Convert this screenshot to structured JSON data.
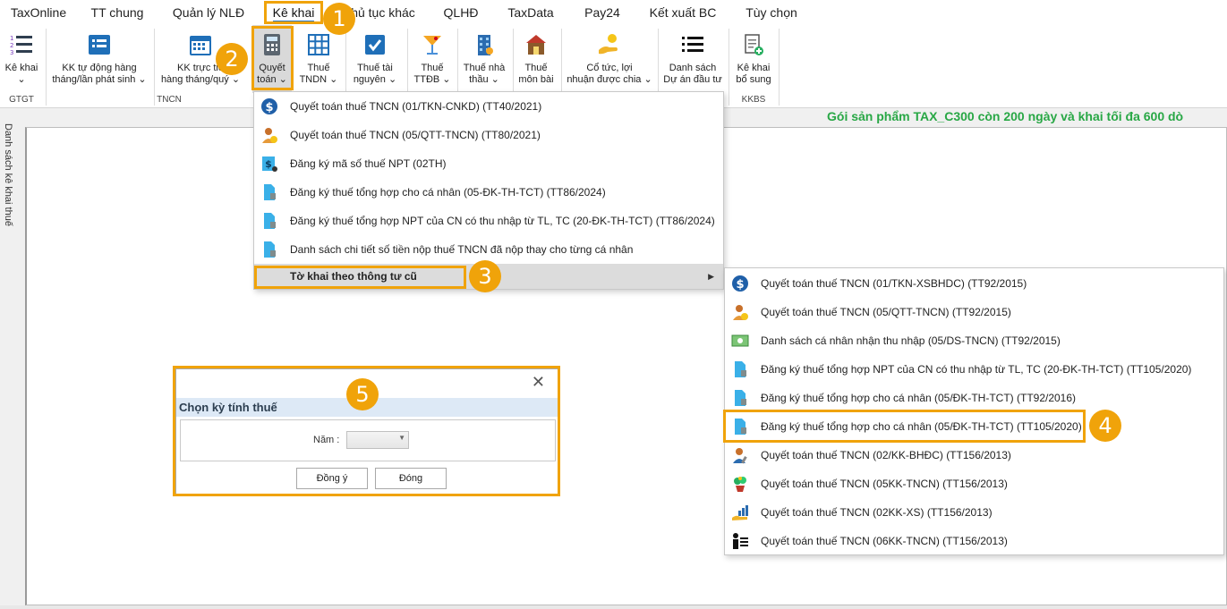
{
  "menu": [
    "TaxOnline",
    "TT chung",
    "Quản lý NLĐ",
    "Kê khai",
    "hủ tục khác",
    "QLHĐ",
    "TaxData",
    "Pay24",
    "Kết xuất BC",
    "Tùy chọn"
  ],
  "ribbon": {
    "buttons": [
      {
        "line1": "Kê khai",
        "line2": "⌄",
        "icon": "numbered-list-icon"
      },
      {
        "line1": "KK tự động hàng",
        "line2": "tháng/lần phát sinh ⌄",
        "icon": "form-list-icon"
      },
      {
        "line1": "KK trực tiế",
        "line2": "hàng tháng/quý ⌄",
        "icon": "calendar-icon"
      },
      {
        "line1": "Quyết",
        "line2": "toán ⌄",
        "icon": "calculator-icon"
      },
      {
        "line1": "Thuế",
        "line2": "TNDN ⌄",
        "icon": "grid-icon"
      },
      {
        "line1": "Thuế tài",
        "line2": "nguyên ⌄",
        "icon": "checkbox-calendar-icon"
      },
      {
        "line1": "Thuế",
        "line2": "TTĐB ⌄",
        "icon": "cocktail-icon"
      },
      {
        "line1": "Thuế nhà",
        "line2": "thầu ⌄",
        "icon": "building-icon"
      },
      {
        "line1": "Thuế",
        "line2": "môn bài",
        "icon": "shop-icon"
      },
      {
        "line1": "Cổ tức, lợi",
        "line2": "nhuận được chia ⌄",
        "icon": "coin-hand-icon"
      },
      {
        "line1": "Danh sách",
        "line2": "Dự án đầu tư",
        "icon": "list-icon"
      },
      {
        "line1": "Kê khai",
        "line2": "bổ sung",
        "icon": "add-document-icon"
      }
    ],
    "groups": [
      "GTGT",
      "TNCN",
      "KKBS"
    ]
  },
  "sidebar_label": "Danh sách kê khai thuế",
  "promo": "Gói sản phẩm TAX_C300 còn 200 ngày và khai tối đa 600 dò",
  "dropdown1": [
    {
      "label": "Quyết toán thuế TNCN (01/TKN-CNKD) (TT40/2021)",
      "icon": "dollar-circle-icon"
    },
    {
      "label": "Quyết toán thuế TNCN (05/QTT-TNCN) (TT80/2021)",
      "icon": "person-coin-icon"
    },
    {
      "label": "Đăng ký mã số thuế NPT (02TH)",
      "icon": "document-dollar-icon"
    },
    {
      "label": "Đăng ký thuế tổng hợp cho cá nhân (05-ĐK-TH-TCT) (TT86/2024)",
      "icon": "document-icon"
    },
    {
      "label": "Đăng ký thuế tổng hợp NPT của CN có thu nhập từ TL, TC (20-ĐK-TH-TCT) (TT86/2024)",
      "icon": "document-icon"
    },
    {
      "label": "Danh sách chi tiết số tiền nộp thuế TNCN đã nộp thay cho từng cá nhân",
      "icon": "document-icon"
    },
    {
      "label": "Tờ khai theo thông tư cũ",
      "icon": "",
      "arrow": "▶"
    }
  ],
  "dropdown2": [
    {
      "label": "Quyết toán thuế TNCN (01/TKN-XSBHDC) (TT92/2015)",
      "icon": "dollar-circle-icon"
    },
    {
      "label": "Quyết toán thuế TNCN (05/QTT-TNCN) (TT92/2015)",
      "icon": "person-coin-icon"
    },
    {
      "label": "Danh sách cá nhân nhận thu nhập (05/DS-TNCN) (TT92/2015)",
      "icon": "money-bill-icon"
    },
    {
      "label": "Đăng ký thuế tổng hợp NPT của CN có thu nhập từ TL, TC (20-ĐK-TH-TCT) (TT105/2020)",
      "icon": "document-icon"
    },
    {
      "label": "Đăng ký thuế tổng hợp cho cá nhân (05/ĐK-TH-TCT) (TT92/2016)",
      "icon": "document-icon"
    },
    {
      "label": "Đăng ký thuế tổng hợp cho cá nhân (05/ĐK-TH-TCT) (TT105/2020)",
      "icon": "document-icon"
    },
    {
      "label": "Quyết toán thuế TNCN (02/KK-BHĐC) (TT156/2013)",
      "icon": "person-pen-icon"
    },
    {
      "label": "Quyết toán thuế TNCN (05KK-TNCN) (TT156/2013)",
      "icon": "plant-pot-icon"
    },
    {
      "label": "Quyết toán thuế TNCN (02KK-XS) (TT156/2013)",
      "icon": "hand-chart-icon"
    },
    {
      "label": "Quyết toán thuế TNCN (06KK-TNCN) (TT156/2013)",
      "icon": "person-list-icon"
    }
  ],
  "dialog": {
    "title": "Chọn kỳ tính thuế",
    "year_label": "Năm :",
    "ok": "Đồng ý",
    "close": "Đóng",
    "close_icon": "✕"
  },
  "badges": [
    "1",
    "2",
    "3",
    "4",
    "5"
  ],
  "colors": {
    "callout": "#f0a30a",
    "promo": "#28a745",
    "dialog_header": "#dde9f6",
    "accent": "#2b79c2"
  }
}
